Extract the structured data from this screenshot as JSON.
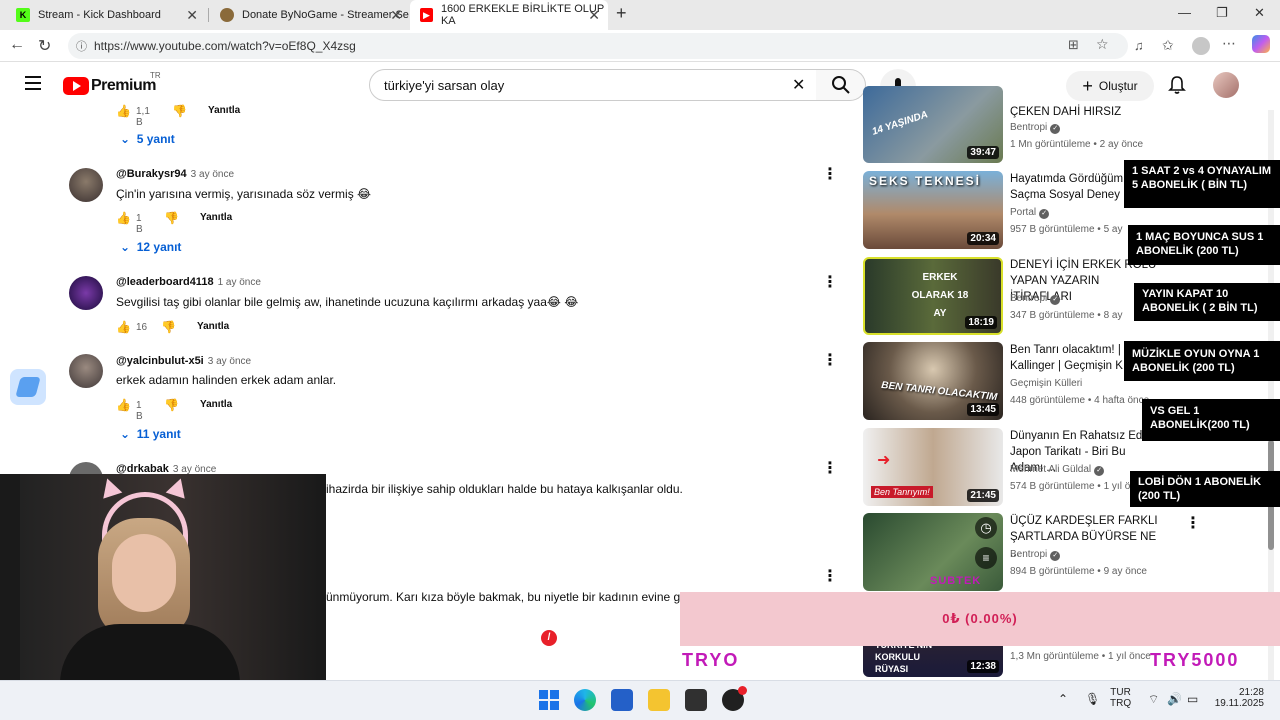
{
  "browser": {
    "tabs": [
      {
        "title": "Stream - Kick Dashboard",
        "favicon": "kick-icon"
      },
      {
        "title": "Donate ByNoGame - Streamer Se",
        "favicon": "bynogame-icon"
      },
      {
        "title": "1600 ERKEKLE BİRLİKTE OLUP KA",
        "favicon": "youtube-icon"
      }
    ],
    "new_tab": "+",
    "url": "https://www.youtube.com/watch?v=oEf8Q_X4zsg"
  },
  "youtube": {
    "logo": "Premium",
    "logo_country": "TR",
    "search_value": "türkiye'yi sarsan olay",
    "create_label": "Oluştur"
  },
  "comments": {
    "top_actions": {
      "likes": "1,1 B",
      "reply": "Yanıtla"
    },
    "top_replies": "5 yanıt",
    "items": [
      {
        "author": "@Burakysr94",
        "time": "3 ay önce",
        "text": "Çin'in yarısına vermiş, yarısınada söz vermiş  😂",
        "likes": "1 B",
        "reply": "Yanıtla",
        "replies": "12 yanıt"
      },
      {
        "author": "@leaderboard4118",
        "time": "1 ay önce",
        "text": "Sevgilisi taş gibi olanlar bile gelmiş aw, ihanetinde ucuzuna kaçılırmı arkadaş yaa😂 😂",
        "likes": "16",
        "reply": "Yanıtla"
      },
      {
        "author": "@yalcinbulut-x5i",
        "time": "3 ay önce",
        "text": "erkek adamın halinden erkek adam anlar.",
        "likes": "1 B",
        "reply": "Yanıtla",
        "replies": "11 yanıt"
      },
      {
        "author": "@drkabak",
        "time": "3 ay önce",
        "text": "ihazirda bir ilişkiye sahip oldukları halde bu hataya kalkışanlar oldu."
      },
      {
        "author": "",
        "time": "",
        "text": "ünmüyorum. Karı kıza böyle bakmak, bu niyetle bir kadının evine gitme"
      }
    ]
  },
  "sidebar": [
    {
      "title": "ÇEKEN DAHİ HIRSIZ",
      "channel": "Bentropi",
      "views": "1 Mn görüntüleme",
      "age": "2 ay önce",
      "duration": "39:47",
      "thumb_text": "14 YAŞINDA"
    },
    {
      "title": "Hayatımda Gördüğüm Saçma Sosyal Deney",
      "channel": "Portal",
      "views": "957 B görüntüleme",
      "age": "5 ay",
      "duration": "20:34",
      "thumb_text": "SEKS TEKNESİ"
    },
    {
      "title": "DENEYİ İÇİN ERKEK ROLÜ YAPAN YAZARIN İTİRAFLARI",
      "channel": "Bentropi",
      "views": "347 B görüntüleme",
      "age": "8 ay",
      "duration": "18:19",
      "thumb_text": "ERKEK OLARAK 18 AY"
    },
    {
      "title": "Ben Tanrı olacaktım! | Kallinger | Geçmişin K",
      "channel": "Geçmişin Külleri",
      "views": "448 görüntüleme",
      "age": "4 hafta önce",
      "duration": "13:45",
      "thumb_text": "BEN TANRI OLACAKTIM"
    },
    {
      "title": "Dünyanın En Rahatsız Edi Japon Tarikatı - Biri Bu Adamı ...",
      "channel": "Mehmet Ali Güldal",
      "views": "574 B görüntüleme",
      "age": "1 yıl ö",
      "duration": "21:45",
      "thumb_text": "Ben Tanrıyım!"
    },
    {
      "title": "ÜÇÜZ KARDEŞLER FARKLI ŞARTLARDA BÜYÜRSE NE ...",
      "channel": "Bentropi",
      "views": "894 B görüntüleme",
      "age": "9 ay önce",
      "duration": ""
    },
    {
      "title": "",
      "channel": "",
      "views": "1,3 Mn görüntüleme",
      "age": "1 yıl önce",
      "duration": "12:38",
      "thumb_text": "TÜRKİYE'NİN KORKULU RÜYASI"
    }
  ],
  "overlays": [
    {
      "text": "1 SAAT 2 vs 4 OYNAYALIM 5 ABONELİK ( BİN TL)"
    },
    {
      "text": "1 MAÇ BOYUNCA SUS 1 ABONELİK (200 TL)"
    },
    {
      "text": "YAYIN KAPAT 10 ABONELİK ( 2 BİN TL)"
    },
    {
      "text": "MÜZİKLE OYUN OYNA 1 ABONELİK (200 TL)"
    },
    {
      "text": "VS GEL 1 ABONELİK(200 TL)"
    },
    {
      "text": "LOBİ DÖN 1 ABONELİK (200 TL)"
    }
  ],
  "donation_bar": {
    "text": "0₺ (0.00%)",
    "progress_percent": 0
  },
  "watermarks": {
    "left": "TRYO",
    "right": "TRY5000",
    "faded": "SUBTEK"
  },
  "taskbar": {
    "lang_top": "TUR",
    "lang_bottom": "TRQ",
    "time": "21:28",
    "date": "19.11.2025"
  },
  "colors": {
    "youtube_red": "#ff0000",
    "link_blue": "#065fd4",
    "donation_pink": "#f3c8cf",
    "donation_text": "#d11f56"
  }
}
